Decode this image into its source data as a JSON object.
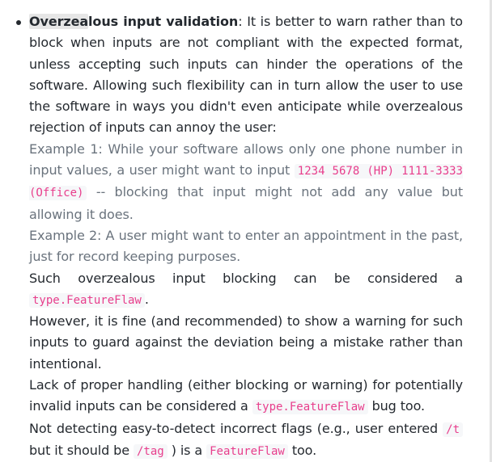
{
  "item": {
    "term_highlight": "Overzea",
    "term_rest": "lous input validation",
    "intro": ": It is better to warn rather than to block when inputs are not compliant with the expected format, unless accepting such inputs can hinder the operations of the software. Allowing such flexibility can in turn allow the user to use the software in ways you didn't even anticipate while overzealous rejection of inputs can annoy the user:",
    "example1_pre": "Example 1: While your software allows only one phone number in input values, a user might want to input",
    "example1_code": "1234 5678 (HP) 1111-3333 (Office)",
    "example1_post": "-- blocking that input might not add any value but allowing it does.",
    "example2": "Example 2: A user might want to enter an appointment in the past, just for record keeping purposes.",
    "such_pre": "Such overzealous input blocking can be considered a",
    "such_code": "type.FeatureFlaw",
    "such_post": ".",
    "however": "However, it is fine (and recommended) to show a warning for such inputs to guard against the deviation being a mistake rather than intentional.",
    "lack_pre": "Lack of proper handling (either blocking or warning) for potentially invalid inputs can be considered a",
    "lack_code": "type.FeatureFlaw",
    "lack_post": "bug too.",
    "detect_pre": "Not detecting easy-to-detect incorrect flags (e.g., user entered",
    "detect_code1": "/t",
    "detect_mid": "but it should be",
    "detect_code2": "/tag",
    "detect_mid2": ") is a",
    "detect_code3": "FeatureFlaw",
    "detect_post": "too."
  }
}
